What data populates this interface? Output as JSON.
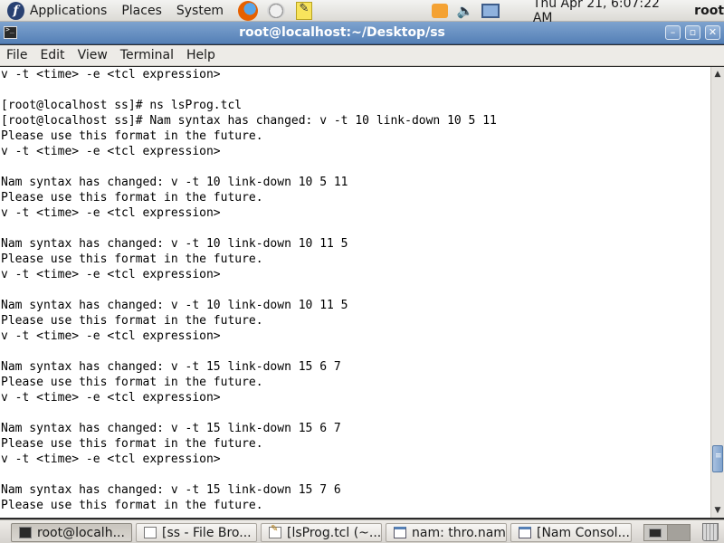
{
  "top_panel": {
    "menus": [
      "Applications",
      "Places",
      "System"
    ],
    "launchers": [
      "firefox-icon",
      "mail-icon",
      "notes-icon"
    ],
    "tray_icons": [
      "rss-icon",
      "volume-icon",
      "network-icon"
    ],
    "clock": "Thu Apr 21,  6:07:22 AM",
    "user": "root"
  },
  "window": {
    "title": "root@localhost:~/Desktop/ss",
    "buttons": {
      "minimize": "–",
      "maximize": "▫",
      "close": "✕"
    }
  },
  "menubar": [
    "File",
    "Edit",
    "View",
    "Terminal",
    "Help"
  ],
  "terminal": {
    "lines": [
      "v -t <time> -e <tcl expression>",
      "",
      "[root@localhost ss]# ns lsProg.tcl",
      "[root@localhost ss]# Nam syntax has changed: v -t 10 link-down 10 5 11",
      "Please use this format in the future.",
      "v -t <time> -e <tcl expression>",
      "",
      "Nam syntax has changed: v -t 10 link-down 10 5 11",
      "Please use this format in the future.",
      "v -t <time> -e <tcl expression>",
      "",
      "Nam syntax has changed: v -t 10 link-down 10 11 5",
      "Please use this format in the future.",
      "v -t <time> -e <tcl expression>",
      "",
      "Nam syntax has changed: v -t 10 link-down 10 11 5",
      "Please use this format in the future.",
      "v -t <time> -e <tcl expression>",
      "",
      "Nam syntax has changed: v -t 15 link-down 15 6 7",
      "Please use this format in the future.",
      "v -t <time> -e <tcl expression>",
      "",
      "Nam syntax has changed: v -t 15 link-down 15 6 7",
      "Please use this format in the future.",
      "v -t <time> -e <tcl expression>",
      "",
      "Nam syntax has changed: v -t 15 link-down 15 7 6",
      "Please use this format in the future."
    ]
  },
  "taskbar": {
    "tasks": [
      {
        "label": "root@localh...",
        "icon": "terminal-icon"
      },
      {
        "label": "[ss - File Bro...",
        "icon": "file-browser-icon"
      },
      {
        "label": "[lsProg.tcl (~...",
        "icon": "text-editor-icon"
      },
      {
        "label": "nam: thro.nam",
        "icon": "window-icon"
      },
      {
        "label": "[Nam Consol...",
        "icon": "window-icon"
      }
    ]
  }
}
